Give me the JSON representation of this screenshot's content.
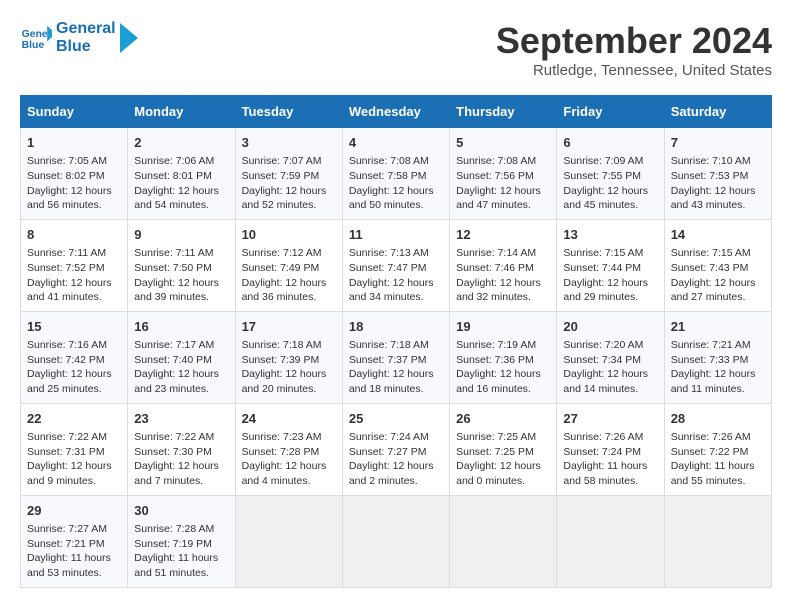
{
  "header": {
    "logo_line1": "General",
    "logo_line2": "Blue",
    "month": "September 2024",
    "location": "Rutledge, Tennessee, United States"
  },
  "weekdays": [
    "Sunday",
    "Monday",
    "Tuesday",
    "Wednesday",
    "Thursday",
    "Friday",
    "Saturday"
  ],
  "weeks": [
    [
      {
        "day": "1",
        "sunrise": "7:05 AM",
        "sunset": "8:02 PM",
        "daylight": "12 hours and 56 minutes."
      },
      {
        "day": "2",
        "sunrise": "7:06 AM",
        "sunset": "8:01 PM",
        "daylight": "12 hours and 54 minutes."
      },
      {
        "day": "3",
        "sunrise": "7:07 AM",
        "sunset": "7:59 PM",
        "daylight": "12 hours and 52 minutes."
      },
      {
        "day": "4",
        "sunrise": "7:08 AM",
        "sunset": "7:58 PM",
        "daylight": "12 hours and 50 minutes."
      },
      {
        "day": "5",
        "sunrise": "7:08 AM",
        "sunset": "7:56 PM",
        "daylight": "12 hours and 47 minutes."
      },
      {
        "day": "6",
        "sunrise": "7:09 AM",
        "sunset": "7:55 PM",
        "daylight": "12 hours and 45 minutes."
      },
      {
        "day": "7",
        "sunrise": "7:10 AM",
        "sunset": "7:53 PM",
        "daylight": "12 hours and 43 minutes."
      }
    ],
    [
      {
        "day": "8",
        "sunrise": "7:11 AM",
        "sunset": "7:52 PM",
        "daylight": "12 hours and 41 minutes."
      },
      {
        "day": "9",
        "sunrise": "7:11 AM",
        "sunset": "7:50 PM",
        "daylight": "12 hours and 39 minutes."
      },
      {
        "day": "10",
        "sunrise": "7:12 AM",
        "sunset": "7:49 PM",
        "daylight": "12 hours and 36 minutes."
      },
      {
        "day": "11",
        "sunrise": "7:13 AM",
        "sunset": "7:47 PM",
        "daylight": "12 hours and 34 minutes."
      },
      {
        "day": "12",
        "sunrise": "7:14 AM",
        "sunset": "7:46 PM",
        "daylight": "12 hours and 32 minutes."
      },
      {
        "day": "13",
        "sunrise": "7:15 AM",
        "sunset": "7:44 PM",
        "daylight": "12 hours and 29 minutes."
      },
      {
        "day": "14",
        "sunrise": "7:15 AM",
        "sunset": "7:43 PM",
        "daylight": "12 hours and 27 minutes."
      }
    ],
    [
      {
        "day": "15",
        "sunrise": "7:16 AM",
        "sunset": "7:42 PM",
        "daylight": "12 hours and 25 minutes."
      },
      {
        "day": "16",
        "sunrise": "7:17 AM",
        "sunset": "7:40 PM",
        "daylight": "12 hours and 23 minutes."
      },
      {
        "day": "17",
        "sunrise": "7:18 AM",
        "sunset": "7:39 PM",
        "daylight": "12 hours and 20 minutes."
      },
      {
        "day": "18",
        "sunrise": "7:18 AM",
        "sunset": "7:37 PM",
        "daylight": "12 hours and 18 minutes."
      },
      {
        "day": "19",
        "sunrise": "7:19 AM",
        "sunset": "7:36 PM",
        "daylight": "12 hours and 16 minutes."
      },
      {
        "day": "20",
        "sunrise": "7:20 AM",
        "sunset": "7:34 PM",
        "daylight": "12 hours and 14 minutes."
      },
      {
        "day": "21",
        "sunrise": "7:21 AM",
        "sunset": "7:33 PM",
        "daylight": "12 hours and 11 minutes."
      }
    ],
    [
      {
        "day": "22",
        "sunrise": "7:22 AM",
        "sunset": "7:31 PM",
        "daylight": "12 hours and 9 minutes."
      },
      {
        "day": "23",
        "sunrise": "7:22 AM",
        "sunset": "7:30 PM",
        "daylight": "12 hours and 7 minutes."
      },
      {
        "day": "24",
        "sunrise": "7:23 AM",
        "sunset": "7:28 PM",
        "daylight": "12 hours and 4 minutes."
      },
      {
        "day": "25",
        "sunrise": "7:24 AM",
        "sunset": "7:27 PM",
        "daylight": "12 hours and 2 minutes."
      },
      {
        "day": "26",
        "sunrise": "7:25 AM",
        "sunset": "7:25 PM",
        "daylight": "12 hours and 0 minutes."
      },
      {
        "day": "27",
        "sunrise": "7:26 AM",
        "sunset": "7:24 PM",
        "daylight": "11 hours and 58 minutes."
      },
      {
        "day": "28",
        "sunrise": "7:26 AM",
        "sunset": "7:22 PM",
        "daylight": "11 hours and 55 minutes."
      }
    ],
    [
      {
        "day": "29",
        "sunrise": "7:27 AM",
        "sunset": "7:21 PM",
        "daylight": "11 hours and 53 minutes."
      },
      {
        "day": "30",
        "sunrise": "7:28 AM",
        "sunset": "7:19 PM",
        "daylight": "11 hours and 51 minutes."
      },
      null,
      null,
      null,
      null,
      null
    ]
  ]
}
